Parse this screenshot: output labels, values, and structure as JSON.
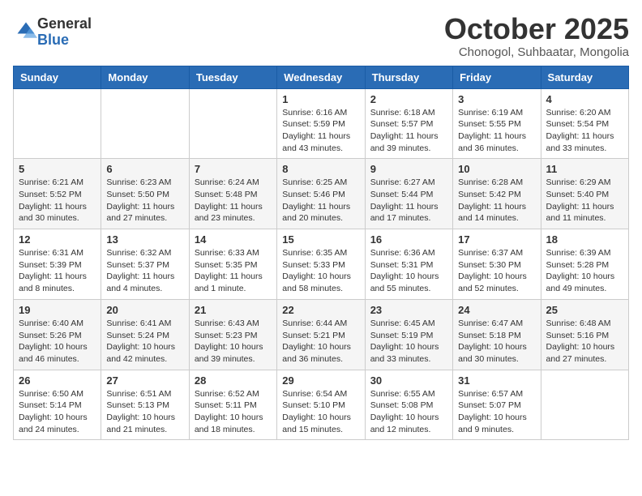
{
  "logo": {
    "general": "General",
    "blue": "Blue"
  },
  "title": {
    "month_year": "October 2025",
    "location": "Chonogol, Suhbaatar, Mongolia"
  },
  "days_of_week": [
    "Sunday",
    "Monday",
    "Tuesday",
    "Wednesday",
    "Thursday",
    "Friday",
    "Saturday"
  ],
  "weeks": [
    [
      {
        "day": "",
        "info": ""
      },
      {
        "day": "",
        "info": ""
      },
      {
        "day": "",
        "info": ""
      },
      {
        "day": "1",
        "info": "Sunrise: 6:16 AM\nSunset: 5:59 PM\nDaylight: 11 hours\nand 43 minutes."
      },
      {
        "day": "2",
        "info": "Sunrise: 6:18 AM\nSunset: 5:57 PM\nDaylight: 11 hours\nand 39 minutes."
      },
      {
        "day": "3",
        "info": "Sunrise: 6:19 AM\nSunset: 5:55 PM\nDaylight: 11 hours\nand 36 minutes."
      },
      {
        "day": "4",
        "info": "Sunrise: 6:20 AM\nSunset: 5:54 PM\nDaylight: 11 hours\nand 33 minutes."
      }
    ],
    [
      {
        "day": "5",
        "info": "Sunrise: 6:21 AM\nSunset: 5:52 PM\nDaylight: 11 hours\nand 30 minutes."
      },
      {
        "day": "6",
        "info": "Sunrise: 6:23 AM\nSunset: 5:50 PM\nDaylight: 11 hours\nand 27 minutes."
      },
      {
        "day": "7",
        "info": "Sunrise: 6:24 AM\nSunset: 5:48 PM\nDaylight: 11 hours\nand 23 minutes."
      },
      {
        "day": "8",
        "info": "Sunrise: 6:25 AM\nSunset: 5:46 PM\nDaylight: 11 hours\nand 20 minutes."
      },
      {
        "day": "9",
        "info": "Sunrise: 6:27 AM\nSunset: 5:44 PM\nDaylight: 11 hours\nand 17 minutes."
      },
      {
        "day": "10",
        "info": "Sunrise: 6:28 AM\nSunset: 5:42 PM\nDaylight: 11 hours\nand 14 minutes."
      },
      {
        "day": "11",
        "info": "Sunrise: 6:29 AM\nSunset: 5:40 PM\nDaylight: 11 hours\nand 11 minutes."
      }
    ],
    [
      {
        "day": "12",
        "info": "Sunrise: 6:31 AM\nSunset: 5:39 PM\nDaylight: 11 hours\nand 8 minutes."
      },
      {
        "day": "13",
        "info": "Sunrise: 6:32 AM\nSunset: 5:37 PM\nDaylight: 11 hours\nand 4 minutes."
      },
      {
        "day": "14",
        "info": "Sunrise: 6:33 AM\nSunset: 5:35 PM\nDaylight: 11 hours\nand 1 minute."
      },
      {
        "day": "15",
        "info": "Sunrise: 6:35 AM\nSunset: 5:33 PM\nDaylight: 10 hours\nand 58 minutes."
      },
      {
        "day": "16",
        "info": "Sunrise: 6:36 AM\nSunset: 5:31 PM\nDaylight: 10 hours\nand 55 minutes."
      },
      {
        "day": "17",
        "info": "Sunrise: 6:37 AM\nSunset: 5:30 PM\nDaylight: 10 hours\nand 52 minutes."
      },
      {
        "day": "18",
        "info": "Sunrise: 6:39 AM\nSunset: 5:28 PM\nDaylight: 10 hours\nand 49 minutes."
      }
    ],
    [
      {
        "day": "19",
        "info": "Sunrise: 6:40 AM\nSunset: 5:26 PM\nDaylight: 10 hours\nand 46 minutes."
      },
      {
        "day": "20",
        "info": "Sunrise: 6:41 AM\nSunset: 5:24 PM\nDaylight: 10 hours\nand 42 minutes."
      },
      {
        "day": "21",
        "info": "Sunrise: 6:43 AM\nSunset: 5:23 PM\nDaylight: 10 hours\nand 39 minutes."
      },
      {
        "day": "22",
        "info": "Sunrise: 6:44 AM\nSunset: 5:21 PM\nDaylight: 10 hours\nand 36 minutes."
      },
      {
        "day": "23",
        "info": "Sunrise: 6:45 AM\nSunset: 5:19 PM\nDaylight: 10 hours\nand 33 minutes."
      },
      {
        "day": "24",
        "info": "Sunrise: 6:47 AM\nSunset: 5:18 PM\nDaylight: 10 hours\nand 30 minutes."
      },
      {
        "day": "25",
        "info": "Sunrise: 6:48 AM\nSunset: 5:16 PM\nDaylight: 10 hours\nand 27 minutes."
      }
    ],
    [
      {
        "day": "26",
        "info": "Sunrise: 6:50 AM\nSunset: 5:14 PM\nDaylight: 10 hours\nand 24 minutes."
      },
      {
        "day": "27",
        "info": "Sunrise: 6:51 AM\nSunset: 5:13 PM\nDaylight: 10 hours\nand 21 minutes."
      },
      {
        "day": "28",
        "info": "Sunrise: 6:52 AM\nSunset: 5:11 PM\nDaylight: 10 hours\nand 18 minutes."
      },
      {
        "day": "29",
        "info": "Sunrise: 6:54 AM\nSunset: 5:10 PM\nDaylight: 10 hours\nand 15 minutes."
      },
      {
        "day": "30",
        "info": "Sunrise: 6:55 AM\nSunset: 5:08 PM\nDaylight: 10 hours\nand 12 minutes."
      },
      {
        "day": "31",
        "info": "Sunrise: 6:57 AM\nSunset: 5:07 PM\nDaylight: 10 hours\nand 9 minutes."
      },
      {
        "day": "",
        "info": ""
      }
    ]
  ]
}
